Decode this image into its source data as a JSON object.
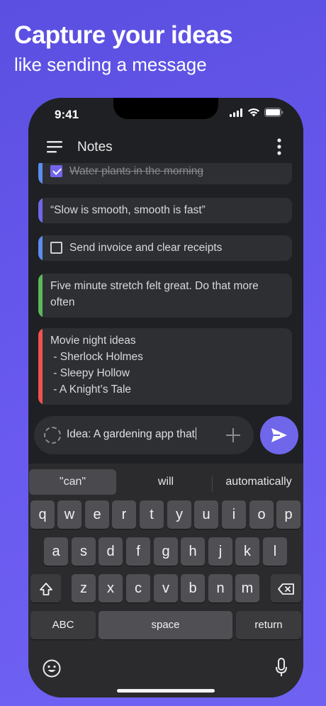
{
  "promo": {
    "headline": "Capture your ideas",
    "subline": "like sending a message"
  },
  "status_bar": {
    "time": "9:41"
  },
  "app_bar": {
    "title": "Notes"
  },
  "notes": [
    {
      "type": "todo",
      "checked": true,
      "text": "Water plants in the morning",
      "accent": "#5b8def"
    },
    {
      "type": "text",
      "text": "“Slow is smooth, smooth is fast”",
      "accent": "#7166ea"
    },
    {
      "type": "todo",
      "checked": false,
      "text": "Send invoice and clear receipts",
      "accent": "#5b8def"
    },
    {
      "type": "text",
      "text": "Five minute stretch felt great. Do that more often",
      "accent": "#5cb85c"
    },
    {
      "type": "list",
      "title": "Movie night ideas",
      "items": [
        " - Sherlock Holmes",
        " - Sleepy Hollow",
        " - A Knight’s Tale"
      ],
      "accent": "#f0524f"
    }
  ],
  "composer": {
    "value": "Idea: A gardening app that",
    "status_icon": "dashed-circle-icon",
    "attach_icon": "plus-icon",
    "send_icon": "send-icon"
  },
  "keyboard": {
    "suggestions": [
      "\"can\"",
      "will",
      "automatically"
    ],
    "row1": [
      "q",
      "w",
      "e",
      "r",
      "t",
      "y",
      "u",
      "i",
      "o",
      "p"
    ],
    "row2": [
      "a",
      "s",
      "d",
      "f",
      "g",
      "h",
      "j",
      "k",
      "l"
    ],
    "row3": [
      "z",
      "x",
      "c",
      "v",
      "b",
      "n",
      "m"
    ],
    "abc_label": "ABC",
    "space_label": "space",
    "return_label": "return"
  },
  "colors": {
    "accent": "#7066ea",
    "background": "#1f2023",
    "card": "#2e2f33"
  }
}
